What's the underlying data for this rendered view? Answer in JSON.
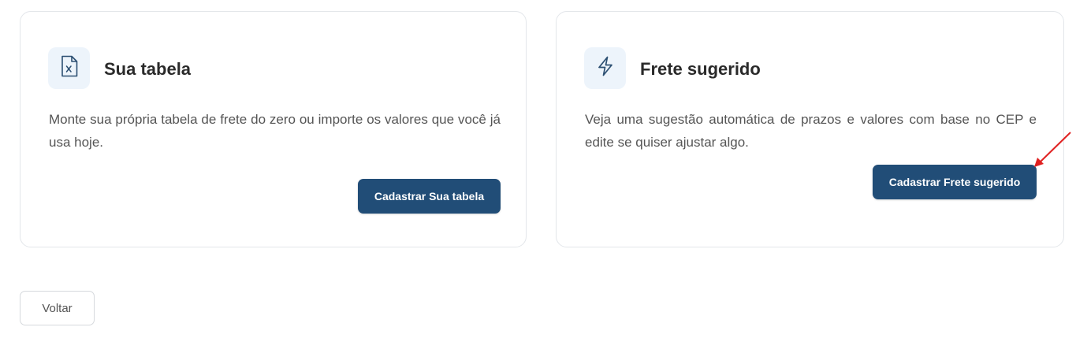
{
  "cards": [
    {
      "title": "Sua tabela",
      "description": "Monte sua própria tabela de frete do zero ou importe os valores que você já usa hoje.",
      "button_label": "Cadastrar Sua tabela",
      "icon": "spreadsheet-file-icon"
    },
    {
      "title": "Frete sugerido",
      "description": "Veja uma sugestão automática de prazos e valores com base no CEP e edite se quiser ajustar algo.",
      "button_label": "Cadastrar Frete sugerido",
      "icon": "lightning-bolt-icon"
    }
  ],
  "back_button": {
    "label": "Voltar"
  },
  "colors": {
    "primary": "#214d77",
    "icon_background": "#edf4fb",
    "annotation_arrow": "#e02020"
  }
}
